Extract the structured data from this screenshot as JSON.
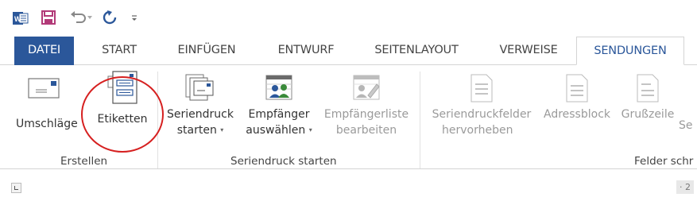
{
  "tabs": [
    {
      "label": "DATEI"
    },
    {
      "label": "START"
    },
    {
      "label": "EINFÜGEN"
    },
    {
      "label": "ENTWURF"
    },
    {
      "label": "SEITENLAYOUT"
    },
    {
      "label": "VERWEISE"
    },
    {
      "label": "SENDUNGEN"
    }
  ],
  "groups": {
    "erstellen": {
      "label": "Erstellen",
      "buttons": [
        {
          "label": "Umschläge"
        },
        {
          "label": "Etiketten"
        }
      ]
    },
    "seriendruck_starten": {
      "label": "Seriendruck starten",
      "buttons": [
        {
          "line1": "Seriendruck",
          "line2": "starten"
        },
        {
          "line1": "Empfänger",
          "line2": "auswählen"
        },
        {
          "line1": "Empfängerliste",
          "line2": "bearbeiten"
        }
      ]
    },
    "felder": {
      "label": "Felder schr",
      "buttons": [
        {
          "line1": "Seriendruckfelder",
          "line2": "hervorheben"
        },
        {
          "label": "Adressblock"
        },
        {
          "label": "Grußzeile"
        },
        {
          "label": "Se"
        }
      ]
    }
  },
  "ruler": {
    "page_number": "· 2"
  },
  "colors": {
    "accent": "#2b579a",
    "circle": "#d62020",
    "word_icon": "#2b579a"
  }
}
